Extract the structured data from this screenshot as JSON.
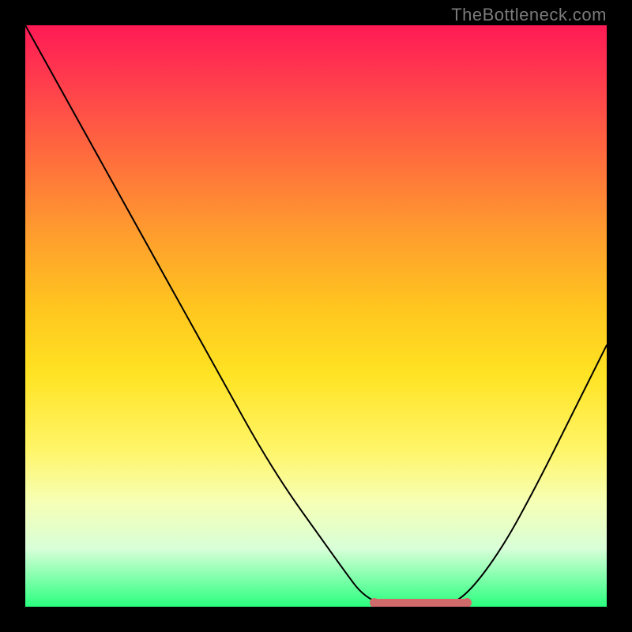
{
  "attribution": "TheBottleneck.com",
  "chart_data": {
    "type": "line",
    "title": "",
    "xlabel": "",
    "ylabel": "",
    "xlim": [
      0,
      1
    ],
    "ylim": [
      0,
      1
    ],
    "series": [
      {
        "name": "bottleneck-curve",
        "x": [
          0.0,
          0.05,
          0.1,
          0.15,
          0.2,
          0.25,
          0.3,
          0.35,
          0.4,
          0.45,
          0.5,
          0.55,
          0.58,
          0.62,
          0.68,
          0.72,
          0.76,
          0.82,
          0.88,
          0.94,
          1.0
        ],
        "y": [
          1.0,
          0.91,
          0.82,
          0.73,
          0.64,
          0.55,
          0.46,
          0.37,
          0.28,
          0.2,
          0.13,
          0.06,
          0.02,
          0.0,
          0.0,
          0.0,
          0.02,
          0.1,
          0.21,
          0.33,
          0.45
        ]
      }
    ],
    "optimal_range": {
      "start": 0.6,
      "end": 0.76
    },
    "gradient_colors": {
      "top": "#ff1a55",
      "mid": "#ffe323",
      "bottom": "#2aff7f"
    }
  }
}
